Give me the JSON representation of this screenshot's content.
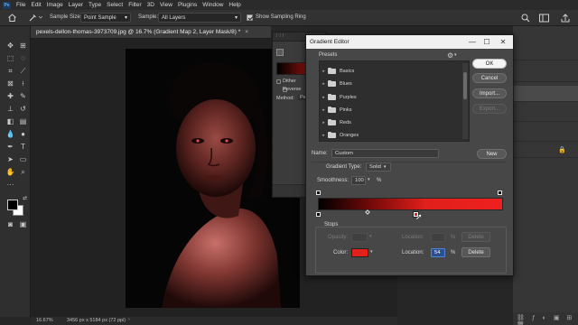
{
  "app": {
    "logo_text": "Ps",
    "menu": [
      "File",
      "Edit",
      "Image",
      "Layer",
      "Type",
      "Select",
      "Filter",
      "3D",
      "View",
      "Plugins",
      "Window",
      "Help"
    ]
  },
  "options_bar": {
    "sample_size_label": "Sample Size:",
    "sample_size_value": "Point Sample",
    "sample_label": "Sample:",
    "sample_value": "All Layers",
    "show_sampling_ring_label": "Show Sampling Ring",
    "show_sampling_ring_checked": true
  },
  "document": {
    "tab_title": "pexels-dellon-thomas-3973709.jpg @ 16.7% (Gradient Map 2, Layer Mask/8) *",
    "close_glyph": "×",
    "zoom": "16.67%",
    "doc_info": "3456 px x 5184 px (72 ppi)"
  },
  "gradient_map_panel": {
    "dither_label": "Dither",
    "reverse_label": "Reverse",
    "method_label": "Method:",
    "method_value": "Pe"
  },
  "gradient_editor": {
    "title": "Gradient Editor",
    "presets_label": "Presets",
    "preset_folders": [
      "Basics",
      "Blues",
      "Purples",
      "Pinks",
      "Reds",
      "Oranges"
    ],
    "buttons": {
      "ok": "OK",
      "cancel": "Cancel",
      "import": "Import...",
      "export": "Export...",
      "new": "New",
      "delete_opacity": "Delete",
      "delete_color": "Delete"
    },
    "name_label": "Name:",
    "name_value": "Custom",
    "gradient_type_label": "Gradient Type:",
    "gradient_type_value": "Solid",
    "smoothness_label": "Smoothness:",
    "smoothness_value": "100",
    "percent": "%",
    "stops_label": "Stops",
    "opacity_label": "Opacity:",
    "location_label": "Location:",
    "color_label": "Color:",
    "color_location_value": "54",
    "stop_color": "#e3211b",
    "gradient_colors": [
      "#000000",
      "#7a0a0a",
      "#e0201b",
      "#ee2020"
    ]
  },
  "colors": {
    "foreground": "#000000",
    "background": "#ffffff",
    "accent": "#ee2020"
  }
}
